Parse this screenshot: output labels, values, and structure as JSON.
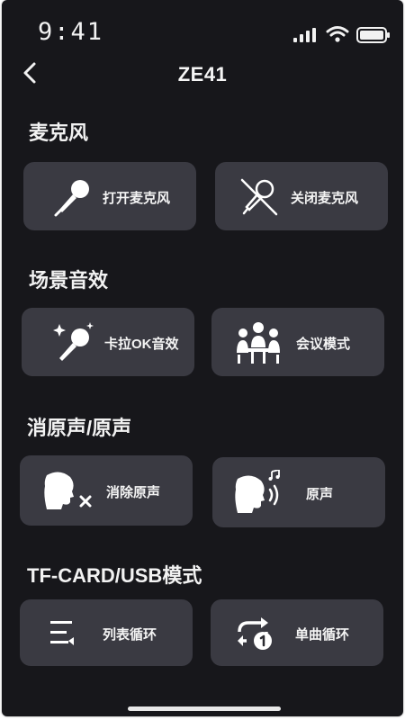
{
  "status_bar": {
    "time": "9:41"
  },
  "header": {
    "title": "ZE41"
  },
  "sections": [
    {
      "title": "麦克风",
      "buttons": [
        {
          "label": "打开麦克风",
          "icon": "microphone-icon"
        },
        {
          "label": "关闭麦克风",
          "icon": "microphone-off-icon"
        }
      ]
    },
    {
      "title": "场景音效",
      "buttons": [
        {
          "label": "卡拉OK音效",
          "icon": "karaoke-microphone-icon"
        },
        {
          "label": "会议模式",
          "icon": "meeting-icon"
        }
      ]
    },
    {
      "title": "消原声/原声",
      "buttons": [
        {
          "label": "消除原声",
          "icon": "vocal-remove-icon"
        },
        {
          "label": "原声",
          "icon": "original-vocal-icon"
        }
      ]
    },
    {
      "title": "TF-CARD/USB模式",
      "buttons": [
        {
          "label": "列表循环",
          "icon": "list-loop-icon"
        },
        {
          "label": "单曲循环",
          "icon": "single-loop-icon"
        }
      ]
    }
  ],
  "colors": {
    "background": "#17171b",
    "button": "#3a3a42",
    "text": "#f4f4f4"
  }
}
